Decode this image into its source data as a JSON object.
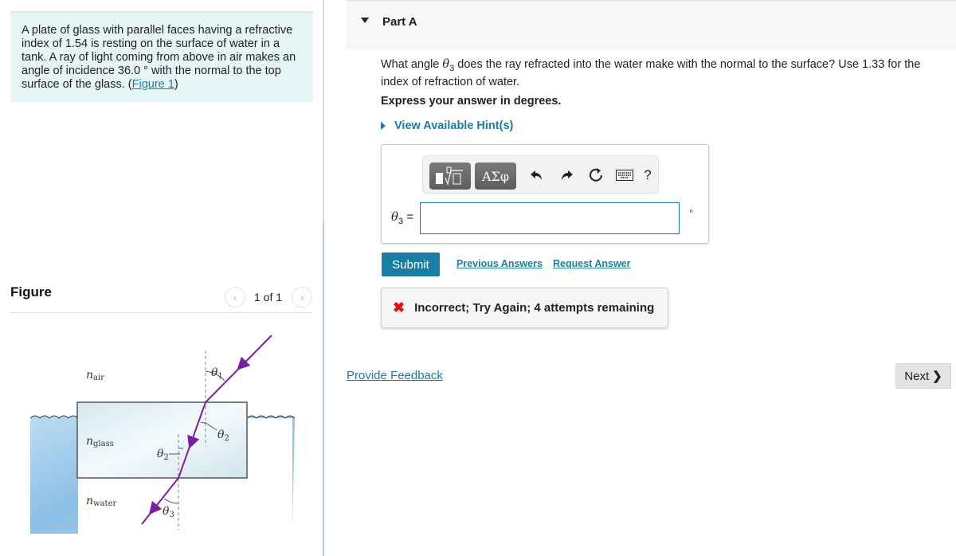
{
  "problem": {
    "text": "A plate of glass with parallel faces having a refractive index of 1.54 is resting on the surface of water in a tank. A ray of light coming from above in air makes an angle of incidence 36.0 ° with the normal to the top surface of the glass. (",
    "figure_link": "Figure 1",
    "close_paren": ")"
  },
  "figure": {
    "title": "Figure",
    "pager": "1 of 1",
    "prev_icon": "chevron-left-icon",
    "next_icon": "chevron-right-icon",
    "labels": {
      "n_air": "n",
      "n_air_sub": "air",
      "n_glass": "n",
      "n_glass_sub": "glass",
      "n_water": "n",
      "n_water_sub": "water",
      "theta1": "θ",
      "theta1_sub": "1",
      "theta2": "θ",
      "theta2_sub": "2",
      "theta2b": "θ",
      "theta2b_sub": "2",
      "theta3": "θ",
      "theta3_sub": "3"
    },
    "colors": {
      "ray": "#7b1fa2",
      "water": "#8fc1e6",
      "glass": "#e4f2f7"
    }
  },
  "part": {
    "title": "Part A",
    "question_pre": "What angle ",
    "question_var": "θ",
    "question_var_sub": "3",
    "question_post": " does the ray refracted into the water make with the normal to the surface? Use 1.33 for the index of refraction of water.",
    "express": "Express your answer in degrees.",
    "hints_label": "View Available Hint(s)"
  },
  "toolbar": {
    "templates_icon": "templates-radical-icon",
    "greek_label": "ΑΣφ",
    "undo_icon": "undo-icon",
    "redo_icon": "redo-icon",
    "reset_icon": "reset-icon",
    "keyboard_icon": "keyboard-icon",
    "help_label": "?"
  },
  "answer": {
    "var": "θ",
    "var_sub": "3",
    "equals": "=",
    "value": "",
    "unit": "°"
  },
  "actions": {
    "submit": "Submit",
    "previous_answers": "Previous Answers",
    "request_answer": "Request Answer"
  },
  "feedback": {
    "status": "incorrect",
    "icon": "✖",
    "text": "Incorrect; Try Again; 4 attempts remaining",
    "color": "#dd1111"
  },
  "footer": {
    "provide_feedback": "Provide Feedback",
    "next": "Next",
    "next_chevron": "❯"
  }
}
